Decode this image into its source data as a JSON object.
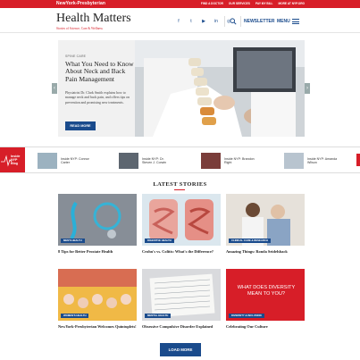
{
  "topbar": {
    "logo": "NewYork-Presbyterian",
    "links": [
      "FIND A DOCTOR",
      "OUR SERVICES",
      "PAY MY BILL",
      "MORE AT NYP.ORG"
    ]
  },
  "header": {
    "brand": "Health Matters",
    "tagline": "Stories of Science, Care & Wellness",
    "newsletter": "NEWSLETTER",
    "menu": "MENU"
  },
  "hero": {
    "category": "SPINE CARE",
    "title": "What You Need to Know About Neck and Back Pain Management",
    "description": "Physiatrist Dr. Clark Smith explains how to manage neck and back pain, and offers tips on prevention and promising new treatments.",
    "button": "READ MORE"
  },
  "ticker": {
    "logo": "Inside NYP Blog",
    "items": [
      {
        "label": "Inside NYP: Connor Carter"
      },
      {
        "label": "Inside NYP: Dr. Steven J. Corwin"
      },
      {
        "label": "Inside NYP: Brandon Right"
      },
      {
        "label": "Inside NYP: Amanda Wilson"
      }
    ]
  },
  "latest": {
    "heading": "LATEST STORIES",
    "cards": [
      {
        "badge": "MEN'S HEALTH",
        "title": "8 Tips for Better Prostate Health"
      },
      {
        "badge": "DIGESTIVE HEALTH",
        "title": "Crohn's vs. Colitis: What's the Difference?"
      },
      {
        "badge": "CLINICAL CARE & RESEARCH",
        "title": "Amazing Things: Ronda Seidelsback"
      },
      {
        "badge": "WOMEN'S HEALTH",
        "title": "NewYork-Presbyterian Welcomes Quintuplets!"
      },
      {
        "badge": "MENTAL HEALTH",
        "title": "Obsessive Compulsive Disorder Explained"
      },
      {
        "badge": "DIVERSITY & INCLUSION",
        "title": "Celebrating Our Culture",
        "image_text": "WHAT DOES DIVERSITY MEAN TO YOU?"
      }
    ],
    "load_more": "LOAD MORE"
  },
  "colors": {
    "accent": "#d71e28",
    "brand": "#1a4b8c"
  }
}
